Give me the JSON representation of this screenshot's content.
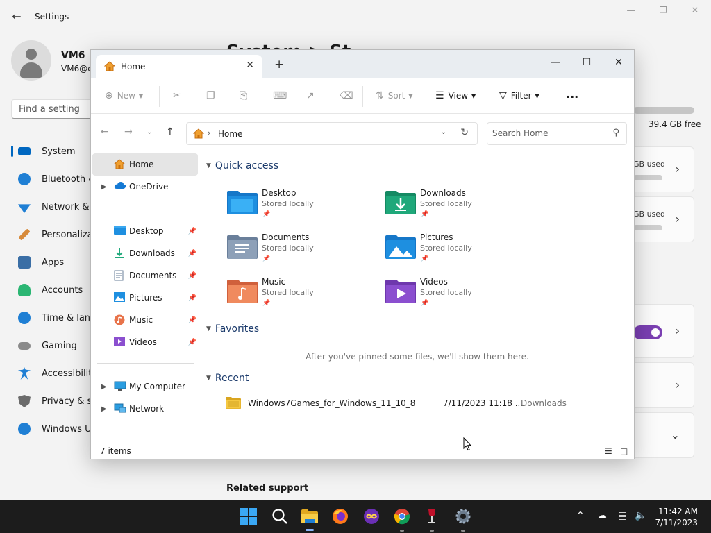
{
  "settings": {
    "title": "Settings",
    "back_icon": "back-arrow-icon",
    "user_name": "VM6",
    "user_email": "VM6@c",
    "search_placeholder": "Find a setting",
    "page_title": "System > St",
    "nav": [
      {
        "label": "System",
        "icon": "system-icon",
        "color": "#0067c0",
        "active": true
      },
      {
        "label": "Bluetooth &",
        "icon": "bluetooth-icon",
        "color": "#1f7fd4"
      },
      {
        "label": "Network &",
        "icon": "network-icon",
        "color": "#1f7fd4"
      },
      {
        "label": "Personaliza",
        "icon": "brush-icon",
        "color": "#d78a3a"
      },
      {
        "label": "Apps",
        "icon": "apps-icon",
        "color": "#3a6ea5"
      },
      {
        "label": "Accounts",
        "icon": "accounts-icon",
        "color": "#2bb673"
      },
      {
        "label": "Time & lang",
        "icon": "time-language-icon",
        "color": "#1f7fd4"
      },
      {
        "label": "Gaming",
        "icon": "gaming-icon",
        "color": "#777777"
      },
      {
        "label": "Accessibility",
        "icon": "accessibility-icon",
        "color": "#1f7fd4"
      },
      {
        "label": "Privacy & se",
        "icon": "privacy-shield-icon",
        "color": "#6b6b6b"
      },
      {
        "label": "Windows U",
        "icon": "windows-update-icon",
        "color": "#1f7fd4"
      }
    ],
    "storage_free": "39.4 GB free",
    "card1_text": "GB used",
    "card2_text": "GB used",
    "related_support": "Related support"
  },
  "explorer": {
    "tab_label": "Home",
    "toolbar": {
      "new": "New",
      "sort": "Sort",
      "view": "View",
      "filter": "Filter",
      "more": "..."
    },
    "address": "Home",
    "search_placeholder": "Search Home",
    "nav_pane": {
      "home": "Home",
      "onedrive": "OneDrive",
      "pinned": [
        {
          "label": "Desktop",
          "icon": "desktop-folder-icon"
        },
        {
          "label": "Downloads",
          "icon": "downloads-folder-icon"
        },
        {
          "label": "Documents",
          "icon": "documents-folder-icon"
        },
        {
          "label": "Pictures",
          "icon": "pictures-folder-icon"
        },
        {
          "label": "Music",
          "icon": "music-folder-icon"
        },
        {
          "label": "Videos",
          "icon": "videos-folder-icon"
        }
      ],
      "my_computer": "My Computer",
      "network": "Network"
    },
    "groups": {
      "quick_access": "Quick access",
      "favorites": "Favorites",
      "recent": "Recent"
    },
    "quick_access": [
      {
        "name": "Desktop",
        "status": "Stored locally",
        "icon": "desktop-folder-icon",
        "color": "#1e8fe0"
      },
      {
        "name": "Downloads",
        "status": "Stored locally",
        "icon": "downloads-folder-icon",
        "color": "#1fa87a"
      },
      {
        "name": "Documents",
        "status": "Stored locally",
        "icon": "documents-folder-icon",
        "color": "#7f93ad"
      },
      {
        "name": "Pictures",
        "status": "Stored locally",
        "icon": "pictures-folder-icon",
        "color": "#1e8fe0"
      },
      {
        "name": "Music",
        "status": "Stored locally",
        "icon": "music-folder-icon",
        "color": "#e8734a"
      },
      {
        "name": "Videos",
        "status": "Stored locally",
        "icon": "videos-folder-icon",
        "color": "#8b4fcf"
      }
    ],
    "favorites_empty": "After you've pinned some files, we'll show them here.",
    "recent": [
      {
        "name": "Windows7Games_for_Windows_11_10_8",
        "date": "7/11/2023 11:18 ...",
        "location": "Downloads",
        "icon": "folder-icon"
      }
    ],
    "status_items": "7 items"
  },
  "taskbar": {
    "apps": [
      {
        "name": "start-button-icon"
      },
      {
        "name": "search-icon"
      },
      {
        "name": "file-explorer-icon"
      },
      {
        "name": "firefox-icon"
      },
      {
        "name": "game-app-icon"
      },
      {
        "name": "chrome-icon"
      },
      {
        "name": "wine-app-icon"
      },
      {
        "name": "settings-gear-icon"
      }
    ],
    "time": "11:42 AM",
    "date": "7/11/2023"
  }
}
